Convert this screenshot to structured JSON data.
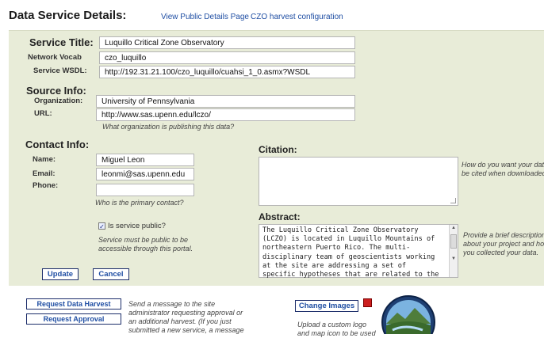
{
  "header": {
    "title": "Data Service Details:",
    "link_public": "View Public Details Page",
    "link_harvest": "CZO harvest configuration"
  },
  "service": {
    "title_label": "Service Title:",
    "title_value": "Luquillo Critical Zone Observatory",
    "vocab_label": "Network Vocab",
    "vocab_value": "czo_luquillo",
    "wsdl_label": "Service WSDL:",
    "wsdl_value": "http://192.31.21.100/czo_luquillo/cuahsi_1_0.asmx?WSDL"
  },
  "source": {
    "heading": "Source Info:",
    "org_label": "Organization:",
    "org_value": "University of Pennsylvania",
    "url_label": "URL:",
    "url_value": "http://www.sas.upenn.edu/lczo/",
    "hint": "What organization is publishing this data?"
  },
  "contact": {
    "heading": "Contact Info:",
    "name_label": "Name:",
    "name_value": "Miguel Leon",
    "email_label": "Email:",
    "email_value": "leonmi@sas.upenn.edu",
    "phone_label": "Phone:",
    "phone_value": "",
    "hint": "Who is the primary contact?"
  },
  "public": {
    "checked": true,
    "label": "Is service public?",
    "hint_line1": "Service must be public to be",
    "hint_line2": "accessible through this portal."
  },
  "citation": {
    "heading": "Citation:",
    "value": "",
    "hint_line1": "How do you want your data",
    "hint_line2": "be cited when downloaded"
  },
  "abstract": {
    "heading": "Abstract:",
    "value": "The Luquillo Critical Zone Observatory\n(LCZO) is located in Luquillo Mountains of\nnortheastern Puerto Rico. The multi-\ndisciplinary team of geoscientists working\nat the site are addressing a set of\nspecific hypotheses that are related to the",
    "hint_line1": "Provide a brief description",
    "hint_line2": "about your project and ho",
    "hint_line3": "you collected your data."
  },
  "actions": {
    "update": "Update",
    "cancel": "Cancel"
  },
  "bottom": {
    "request_harvest": "Request Data Harvest",
    "request_approval": "Request Approval",
    "send_msg_line1": "Send a message to the site",
    "send_msg_line2": "administrator requesting approval or",
    "send_msg_line3": "an additional harvest. (If you just",
    "send_msg_line4": "submitted a new service, a message",
    "change_images": "Change Images",
    "upload_line1": "Upload a custom logo",
    "upload_line2": "and map icon to be used"
  },
  "colors": {
    "panel_bg": "#e8ecd8",
    "link": "#1f4ea3",
    "button_border": "#1c2d6a",
    "status_red": "#cc1f1f"
  }
}
